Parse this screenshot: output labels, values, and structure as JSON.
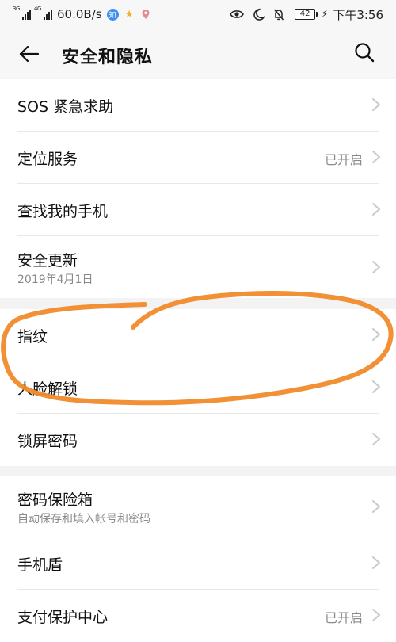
{
  "status_bar": {
    "signal_1_tag": "3G",
    "signal_2_tag": "4G",
    "speed": "60.0B/s",
    "app_badge_label": "知",
    "battery_level": "42",
    "time": "下午3:56"
  },
  "app_bar": {
    "title": "安全和隐私"
  },
  "groups": [
    {
      "items": [
        {
          "label": "SOS 紧急求助"
        },
        {
          "label": "定位服务",
          "value": "已开启"
        },
        {
          "label": "查找我的手机"
        },
        {
          "label": "安全更新",
          "sublabel": "2019年4月1日"
        }
      ]
    },
    {
      "items": [
        {
          "label": "指纹"
        },
        {
          "label": "人脸解锁"
        },
        {
          "label": "锁屏密码"
        }
      ]
    },
    {
      "items": [
        {
          "label": "密码保险箱",
          "sublabel": "自动保存和填入帐号和密码"
        },
        {
          "label": "手机盾"
        },
        {
          "label": "支付保护中心",
          "value": "已开启"
        }
      ]
    }
  ],
  "colors": {
    "annotation_stroke": "#f08a2a",
    "page_bg": "#f3f3f3",
    "list_bg": "#ffffff"
  }
}
